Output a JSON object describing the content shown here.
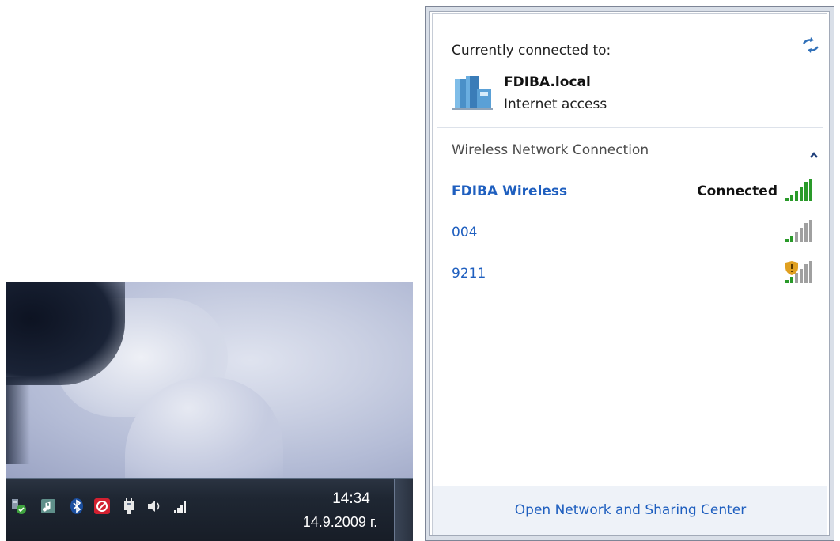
{
  "taskbar": {
    "tray_icons": [
      "windows-update-icon",
      "media-player-icon",
      "bluetooth-icon",
      "antivirus-icon",
      "power-icon",
      "volume-icon",
      "network-signal-icon"
    ],
    "time": "14:34",
    "date": "14.9.2009 г."
  },
  "flyout": {
    "currently_connected_label": "Currently connected to:",
    "current_network": {
      "name": "FDIBA.local",
      "access": "Internet access",
      "icon": "network-building-icon"
    },
    "refresh_icon": "refresh-icon",
    "section": {
      "header": "Wireless Network Connection",
      "collapse_icon": "chevron-up-icon"
    },
    "networks": [
      {
        "name": "FDIBA Wireless",
        "status": "Connected",
        "bold": true,
        "secured": true,
        "signal_level": 5
      },
      {
        "name": "004",
        "status": "",
        "bold": false,
        "secured": true,
        "signal_level": 2
      },
      {
        "name": "9211",
        "status": "",
        "bold": false,
        "secured": false,
        "signal_level": 2
      }
    ],
    "footer_link": "Open Network and Sharing Center"
  },
  "colors": {
    "link_blue": "#1f5fbf",
    "signal_green": "#2a9a2a",
    "signal_gray": "#a0a0a0",
    "footer_bg": "#eef2f8"
  }
}
